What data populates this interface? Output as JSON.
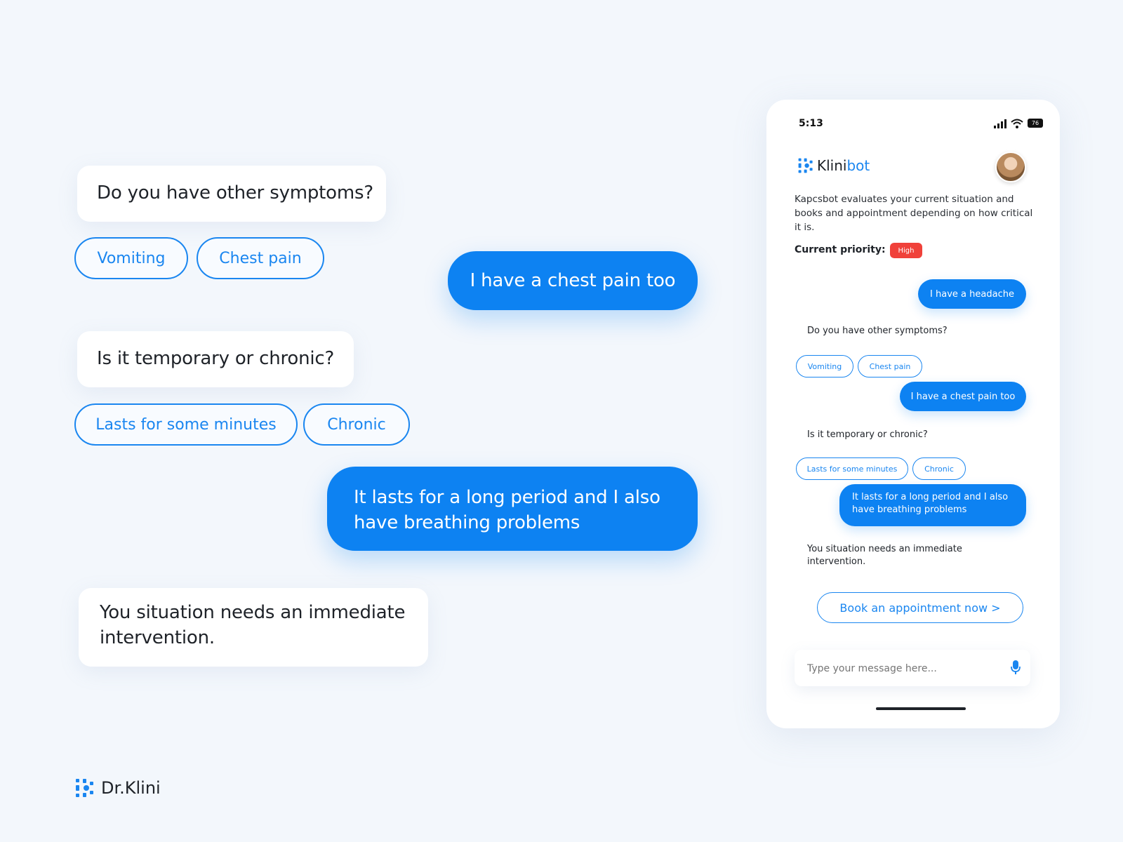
{
  "left": {
    "q1": "Do you have other symptoms?",
    "q1_options": [
      "Vomiting",
      "Chest pain"
    ],
    "reply1": "I have a chest pain too",
    "q2": "Is it temporary or chronic?",
    "q2_options": [
      "Lasts for some minutes",
      "Chronic"
    ],
    "reply2_line1": "It lasts for a long period and I also",
    "reply2_line2": "have breathing problems",
    "verdict_line1": "You situation needs an immediate",
    "verdict_line2": "intervention."
  },
  "brand": {
    "name": "Dr.Klini"
  },
  "phone": {
    "time": "5:13",
    "battery": "76",
    "app_name_a": "Klini",
    "app_name_b": "bot",
    "intro": "Kapcsbot evaluates your current situation and books and appointment depending on how critical it is.",
    "priority_label": "Current priority:",
    "priority_value": "High",
    "msg_headache": "I have a headache",
    "q1": "Do you have other symptoms?",
    "q1_options": [
      "Vomiting",
      "Chest pain"
    ],
    "reply1": "I have a chest pain too",
    "q2": "Is it temporary or chronic?",
    "q2_options": [
      "Lasts for some minutes",
      "Chronic"
    ],
    "reply2": "It lasts for a long period and I also have breathing problems",
    "verdict": "You situation needs an immediate intervention.",
    "book_button": "Book an appointment now >",
    "input_placeholder": "Type your message here...",
    "accent": "#0d82f2",
    "priority_color": "#f0413a"
  },
  "icons": [
    "klini-logo-icon",
    "signal-icon",
    "wifi-icon",
    "battery-icon",
    "avatar",
    "microphone-icon"
  ]
}
